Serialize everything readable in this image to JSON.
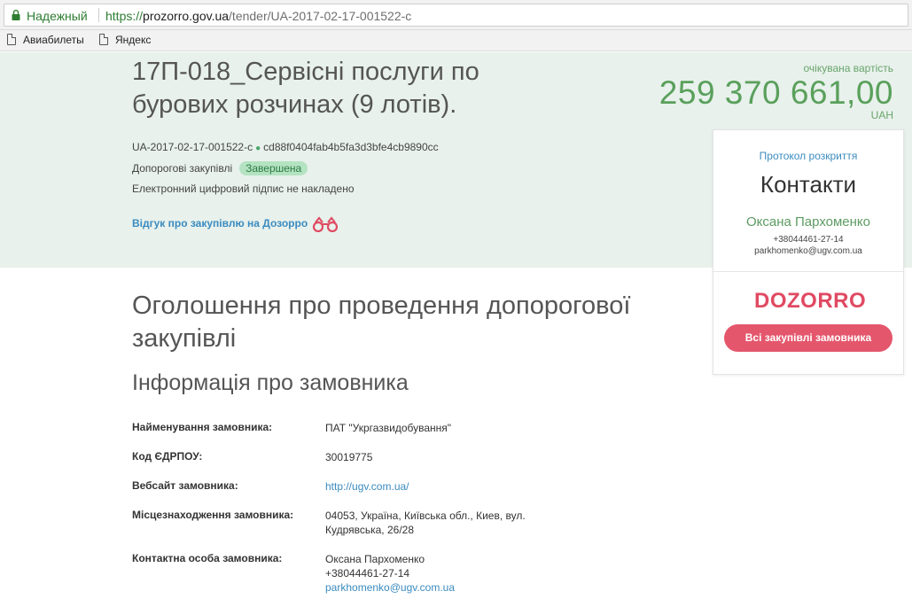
{
  "browser": {
    "secure_label": "Надежный",
    "url_protocol": "https://",
    "url_host": "prozorro.gov.ua",
    "url_path": "/tender/UA-2017-02-17-001522-c",
    "bookmarks": [
      "Авиабилеты",
      "Яндекс"
    ]
  },
  "tender": {
    "title": "17П-018_Сервісні послуги по бурових розчинах (9 лотів).",
    "id": "UA-2017-02-17-001522-c",
    "hash": "cd88f0404fab4b5fa3d3bfe4cb9890cc",
    "procedure_type": "Допорогові закупівлі",
    "status": "Завершена",
    "signature_note": "Електронний цифровий підпис не накладено",
    "dozorro_review": "Відгук про закупівлю на Дозорро"
  },
  "value": {
    "label": "очікувана вартість",
    "amount": "259 370 661,00",
    "currency": "UAH"
  },
  "card": {
    "protocol_link": "Протокол розкриття",
    "title": "Контакти",
    "contact_name": "Оксана Пархоменко",
    "contact_phone": "+38044461-27-14",
    "contact_email": "parkhomenko@ugv.com.ua",
    "logo_text": "DOZORRO",
    "button_label": "Всі закупівлі замовника"
  },
  "main": {
    "announcement_title": "Оголошення про проведення допорогової закупівлі",
    "section_title": "Інформація про замовника",
    "rows": [
      {
        "label": "Найменування замовника:",
        "value": "ПАТ \"Укргазвидобування\""
      },
      {
        "label": "Код ЄДРПОУ:",
        "value": "30019775"
      },
      {
        "label": "Вебсайт замовника:",
        "value": "http://ugv.com.ua/"
      },
      {
        "label": "Місцезнаходження замовника:",
        "value_line1": "04053, Україна, Київська обл., Киев, вул.",
        "value_line2": "Кудрявська, 26/28"
      },
      {
        "label": "Контактна особа замовника:",
        "name": "Оксана Пархоменко",
        "phone": "+38044461-27-14",
        "email": "parkhomenko@ugv.com.ua"
      }
    ]
  },
  "colors": {
    "hero_bg": "#e8f1ec",
    "accent_green": "#5aa05c",
    "link_blue": "#3b8bbf",
    "dozorro_red": "#e04a62",
    "status_badge_bg": "#b4e3c1"
  }
}
